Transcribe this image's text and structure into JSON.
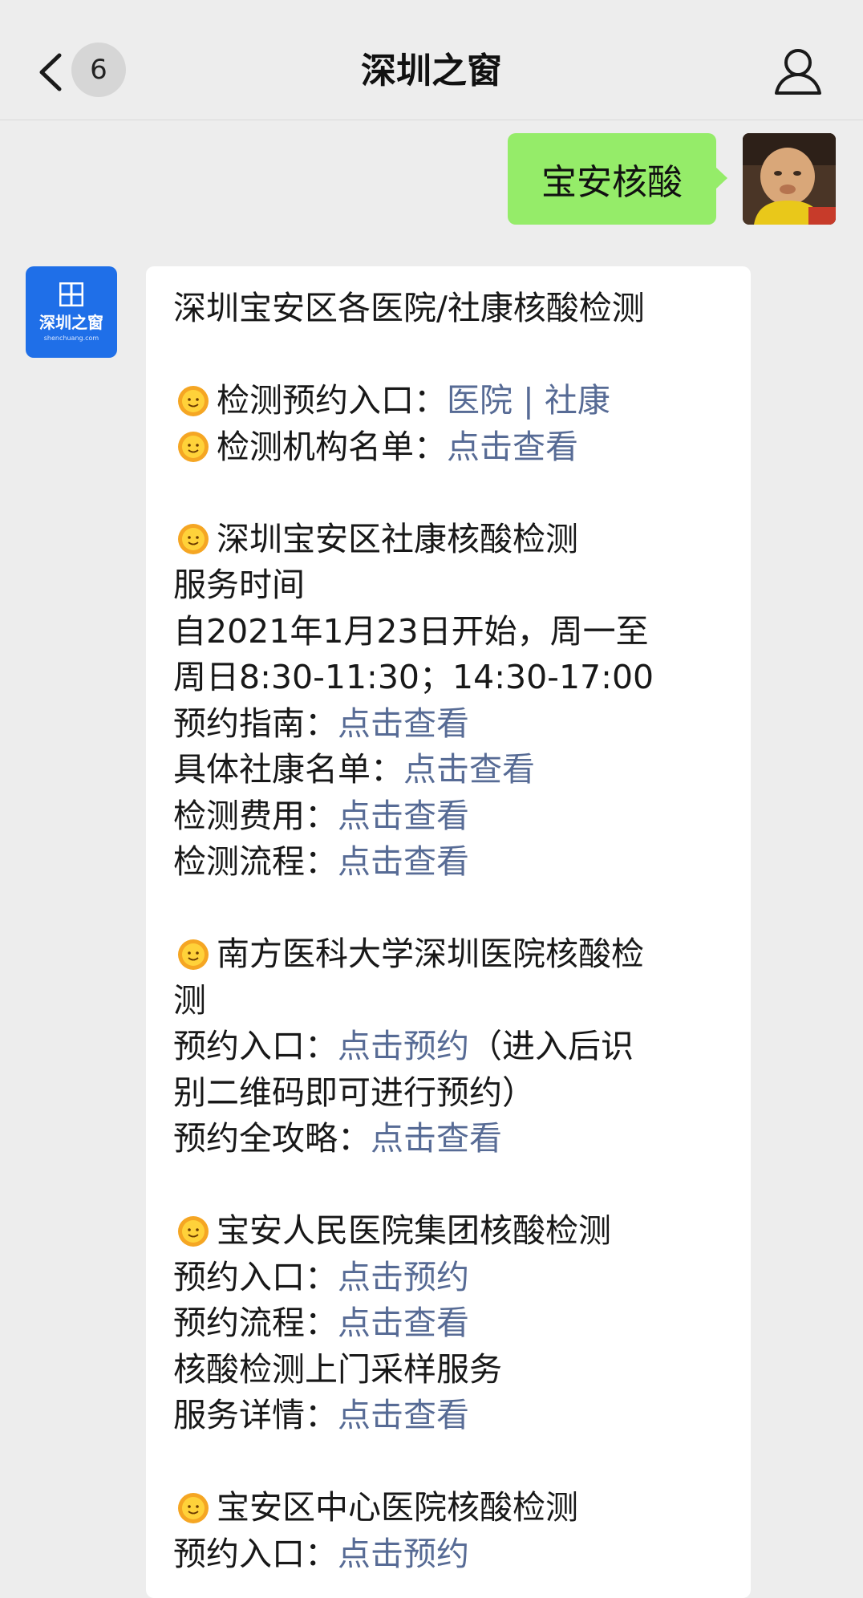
{
  "header": {
    "title": "深圳之窗",
    "unread_count": "6",
    "back_icon": "chevron-left-icon",
    "profile_icon": "person-icon"
  },
  "sent_message": {
    "text": "宝安核酸"
  },
  "account": {
    "avatar_text": "深圳之窗",
    "avatar_domain": "shenchuang.com",
    "brand_color": "#1f6fe8"
  },
  "colors": {
    "link": "#576b95",
    "sent_bubble": "#95ec69",
    "background": "#ededed"
  },
  "reply": {
    "title": "深圳宝安区各医院/社康核酸检测",
    "s1": {
      "l1_label": "检测预约入口：",
      "l1_link1": "医院",
      "l1_sep": " | ",
      "l1_link2": "社康",
      "l2_label": "检测机构名单：",
      "l2_link": "点击查看"
    },
    "s2": {
      "heading": "深圳宝安区社康核酸检测",
      "line1": "服务时间",
      "line2": "自2021年1月23日开始，周一至",
      "line3": "周日8:30-11:30；14:30-17:00",
      "guide_label": "预约指南：",
      "guide_link": "点击查看",
      "list_label": "具体社康名单：",
      "list_link": "点击查看",
      "fee_label": "检测费用：",
      "fee_link": "点击查看",
      "flow_label": "检测流程：",
      "flow_link": "点击查看"
    },
    "s3": {
      "heading1": "南方医科大学深圳医院核酸检",
      "heading2": "测",
      "entry_label": "预约入口：",
      "entry_link": "点击预约",
      "entry_note": "（进入后识",
      "entry_note2": "别二维码即可进行预约）",
      "guide_label": "预约全攻略：",
      "guide_link": "点击查看"
    },
    "s4": {
      "heading": "宝安人民医院集团核酸检测",
      "entry_label": "预约入口：",
      "entry_link": "点击预约",
      "flow_label": "预约流程：",
      "flow_link": "点击查看",
      "service": "核酸检测上门采样服务",
      "detail_label": "服务详情：",
      "detail_link": "点击查看"
    },
    "s5": {
      "heading": "宝安区中心医院核酸检测",
      "entry_label": "预约入口：",
      "entry_link": "点击预约"
    }
  }
}
